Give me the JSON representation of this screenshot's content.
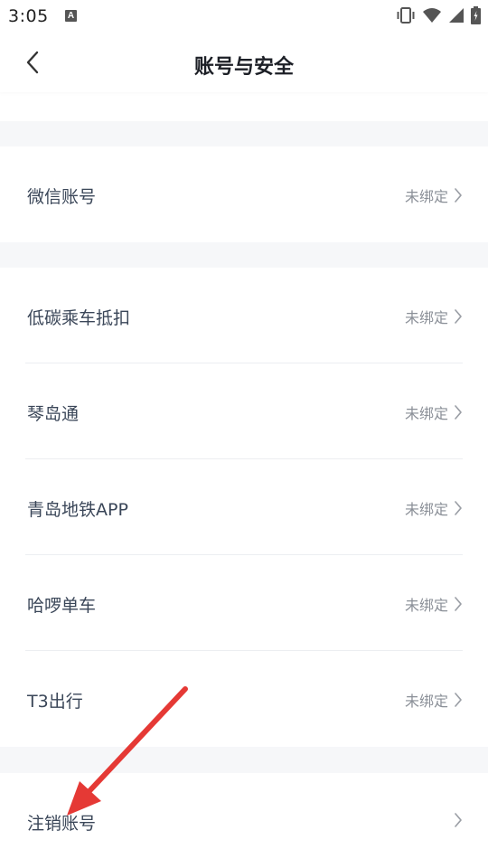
{
  "status_bar": {
    "time": "3:05",
    "badge": "A"
  },
  "header": {
    "title": "账号与安全"
  },
  "sections": {
    "wechat": {
      "label": "微信账号",
      "status": "未绑定"
    },
    "bindings": [
      {
        "label": "低碳乘车抵扣",
        "status": "未绑定"
      },
      {
        "label": "琴岛通",
        "status": "未绑定"
      },
      {
        "label": "青岛地铁APP",
        "status": "未绑定"
      },
      {
        "label": "哈啰单车",
        "status": "未绑定"
      },
      {
        "label": "T3出行",
        "status": "未绑定"
      }
    ],
    "cancel": {
      "label": "注销账号"
    }
  },
  "colors": {
    "accent_arrow": "#e53935",
    "gap_bg": "#f6f7f9"
  },
  "icons": [
    "back-chevron-icon",
    "chevron-right-icon",
    "vibrate-icon",
    "wifi-icon",
    "signal-icon",
    "battery-icon"
  ]
}
